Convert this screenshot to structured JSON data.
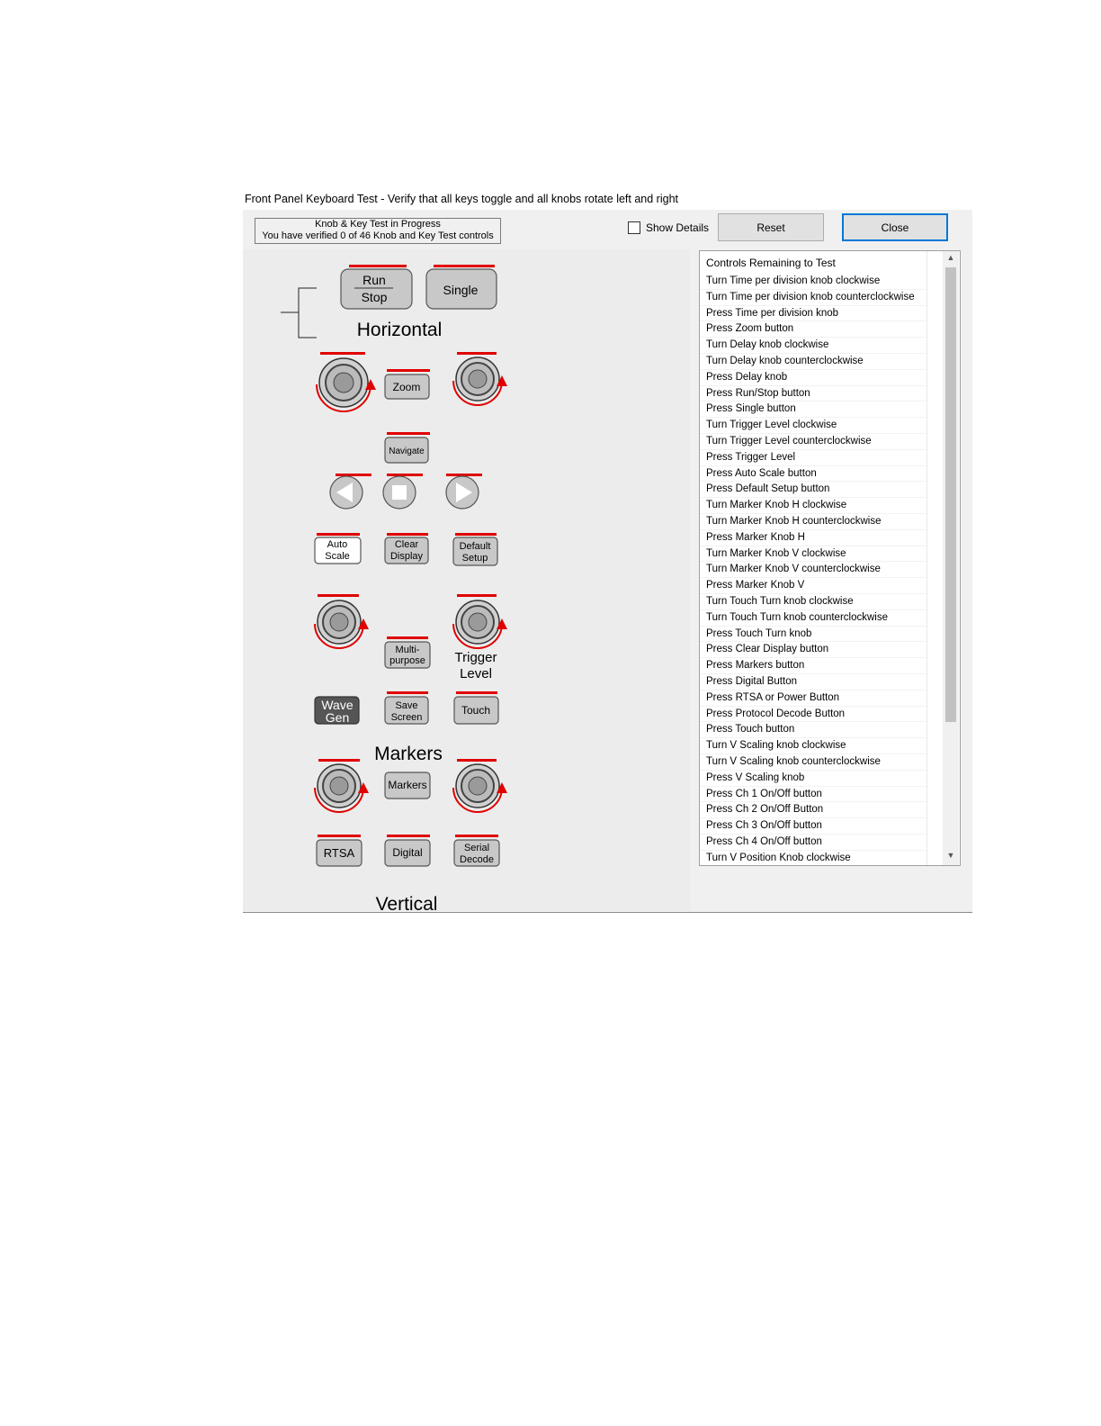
{
  "window": {
    "title": "Front Panel Keyboard Test  - Verify that all keys toggle and all knobs rotate left and right",
    "status_line1": "Knob & Key Test in Progress",
    "status_line2": "You have verified 0 of 46 Knob and Key Test controls",
    "show_details_label": "Show Details",
    "show_details_checked": false,
    "reset_label": "Reset",
    "close_label": "Close"
  },
  "panel": {
    "section_horizontal": "Horizontal",
    "section_markers": "Markers",
    "section_vertical": "Vertical",
    "trigger_label_1": "Trigger",
    "trigger_label_2": "Level",
    "buttons": {
      "run": "Run",
      "stop": "Stop",
      "single": "Single",
      "zoom": "Zoom",
      "navigate": "Navigate",
      "auto_1": "Auto",
      "auto_2": "Scale",
      "clear_1": "Clear",
      "clear_2": "Display",
      "default_1": "Default",
      "default_2": "Setup",
      "multi_1": "Multi-",
      "multi_2": "purpose",
      "wave_1": "Wave",
      "wave_2": "Gen",
      "save_1": "Save",
      "save_2": "Screen",
      "touch": "Touch",
      "markers": "Markers",
      "rtsa": "RTSA",
      "digital": "Digital",
      "serial_1": "Serial",
      "serial_2": "Decode"
    },
    "status_bar_color": "#e00000"
  },
  "list": {
    "header": "Controls Remaining to Test",
    "items": [
      "Turn Time per division knob clockwise",
      "Turn Time per division knob counterclockwise",
      "Press Time per division knob",
      "Press Zoom button",
      "Turn Delay knob clockwise",
      "Turn Delay knob counterclockwise",
      "Press Delay knob",
      "Press Run/Stop button",
      "Press Single button",
      "Turn Trigger Level clockwise",
      "Turn Trigger Level counterclockwise",
      "Press Trigger Level",
      "Press Auto Scale button",
      "Press Default Setup button",
      "Turn Marker Knob H clockwise",
      "Turn Marker Knob H counterclockwise",
      "Press Marker Knob H",
      "Turn Marker Knob V clockwise",
      "Turn Marker Knob V counterclockwise",
      "Press Marker Knob V",
      "Turn Touch Turn knob clockwise",
      "Turn Touch Turn knob counterclockwise",
      "Press Touch Turn knob",
      "Press Clear Display button",
      "Press Markers button",
      "Press Digital Button",
      "Press RTSA or Power Button",
      "Press Protocol Decode Button",
      "Press Touch button",
      "Turn V Scaling knob clockwise",
      "Turn V Scaling knob counterclockwise",
      "Press V Scaling knob",
      "Press Ch 1 On/Off button",
      "Press Ch 2 On/Off Button",
      "Press Ch 3 On/Off button",
      "Press Ch 4 On/Off button",
      "Turn V Position Knob clockwise"
    ]
  }
}
